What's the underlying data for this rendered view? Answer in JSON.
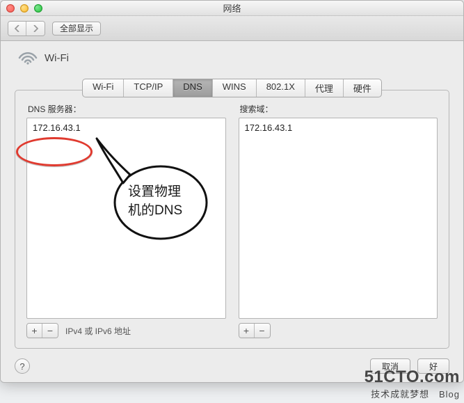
{
  "window": {
    "title": "网络"
  },
  "toolbar": {
    "show_all": "全部显示"
  },
  "header": {
    "connection": "Wi-Fi"
  },
  "tabs": {
    "items": [
      {
        "label": "Wi-Fi"
      },
      {
        "label": "TCP/IP"
      },
      {
        "label": "DNS"
      },
      {
        "label": "WINS"
      },
      {
        "label": "802.1X"
      },
      {
        "label": "代理"
      },
      {
        "label": "硬件"
      }
    ],
    "active_index": 2
  },
  "dns": {
    "servers_label": "DNS 服务器：",
    "servers": [
      "172.16.43.1"
    ],
    "suffix_hint": "IPv4 或 IPv6 地址",
    "domains_label": "搜索域：",
    "domains": [
      "172.16.43.1"
    ]
  },
  "footer": {
    "help": "?",
    "cancel": "取消",
    "ok": "好"
  },
  "annotation": {
    "callout_line1": "设置物理",
    "callout_line2": "机的DNS"
  },
  "watermark": {
    "site": "51CTO.com",
    "subtitle": "技术成就梦想",
    "tag": "Blog"
  },
  "icons": {
    "plus": "+",
    "minus": "−"
  }
}
